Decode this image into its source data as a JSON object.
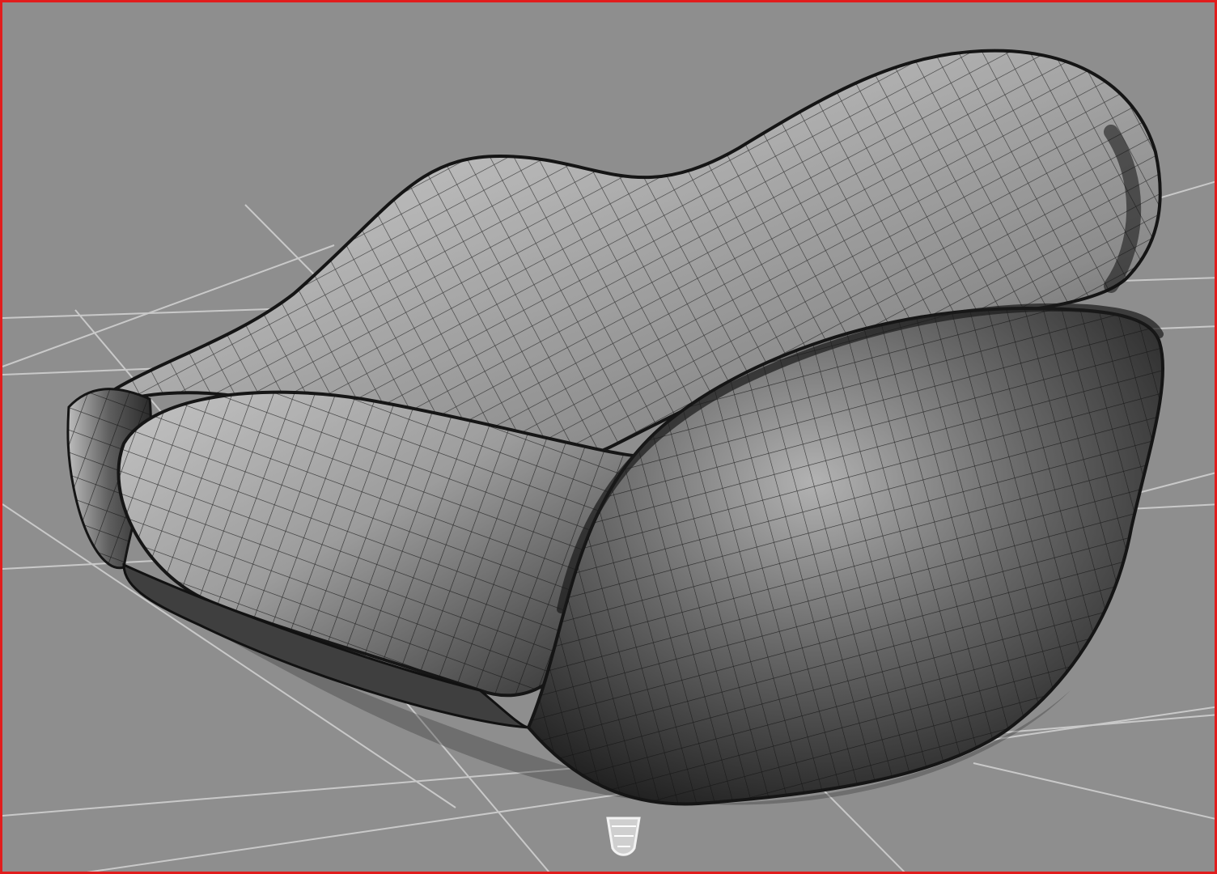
{
  "viewport": {
    "active": true,
    "border_color": "#e11d1d",
    "background_color": "#8e8e8e",
    "grid_color": "#c8c8c8"
  },
  "model": {
    "object": "sofa",
    "display_mode": "smooth-shaded-wireframe",
    "surface_color_light": "#b8b8b8",
    "surface_color_dark": "#242424",
    "wire_color": "#111111"
  }
}
